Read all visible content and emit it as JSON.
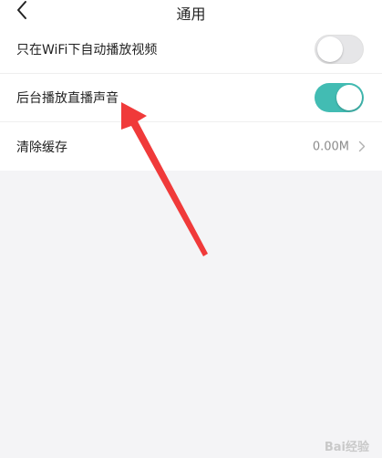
{
  "header": {
    "title": "通用"
  },
  "settings": {
    "wifi_autoplay": {
      "label": "只在WiFi下自动播放视频",
      "enabled": false
    },
    "background_audio": {
      "label": "后台播放直播声音",
      "enabled": true
    },
    "clear_cache": {
      "label": "清除缓存",
      "value": "0.00M"
    }
  },
  "colors": {
    "toggle_on": "#42bcb3",
    "toggle_off": "#e6e6e8",
    "annotation_arrow": "#f03a3a"
  },
  "icons": {
    "back": "chevron-left-icon",
    "row_chevron": "chevron-right-icon"
  },
  "watermark": "Bai经验"
}
